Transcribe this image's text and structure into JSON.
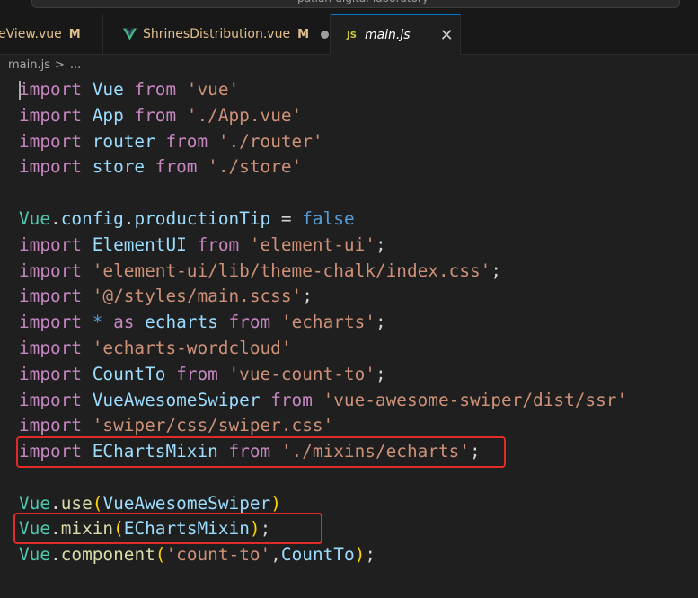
{
  "window": {
    "search_text": "patian-digital-laboratory"
  },
  "tabs": [
    {
      "label": "eView.vue",
      "status": "M"
    },
    {
      "label": "ShrinesDistribution.vue",
      "status": "M",
      "icon": "vue-icon",
      "modified_dot": true
    },
    {
      "label": "main.js",
      "icon_text": "JS",
      "active": true
    }
  ],
  "breadcrumb": {
    "file": "main.js",
    "separator": ">",
    "more": "..."
  },
  "code": {
    "l1": [
      "import",
      " Vue ",
      "from",
      " 'vue'"
    ],
    "l2": [
      "import",
      " App ",
      "from",
      " './App.vue'"
    ],
    "l3": [
      "import",
      " router ",
      "from",
      " './router'"
    ],
    "l4": [
      "import",
      " store ",
      "from",
      " './store'"
    ],
    "l6": [
      "Vue",
      ".",
      "config",
      ".",
      "productionTip",
      " = ",
      "false"
    ],
    "l7": [
      "import",
      " ElementUI ",
      "from",
      " 'element-ui'",
      ";"
    ],
    "l8": [
      "import",
      " 'element-ui/lib/theme-chalk/index.css'",
      ";"
    ],
    "l9": [
      "import",
      " '@/styles/main.scss'",
      ";"
    ],
    "l10": [
      "import",
      " * ",
      "as",
      " echarts ",
      "from",
      " 'echarts'",
      ";"
    ],
    "l11": [
      "import",
      " 'echarts-wordcloud'"
    ],
    "l12": [
      "import",
      " CountTo ",
      "from",
      " 'vue-count-to'",
      ";"
    ],
    "l13": [
      "import",
      " VueAwesomeSwiper ",
      "from",
      " 'vue-awesome-swiper/dist/ssr'"
    ],
    "l14": [
      "import",
      " 'swiper/css/swiper.css'"
    ],
    "l15": [
      "import",
      " EChartsMixin ",
      "from",
      " './mixins/echarts'",
      ";"
    ],
    "l17": [
      "Vue",
      ".",
      "use",
      "(",
      "VueAwesomeSwiper",
      ")"
    ],
    "l18": [
      "Vue",
      ".",
      "mixin",
      "(",
      "EChartsMixin",
      ")",
      ";"
    ],
    "l19": [
      "Vue",
      ".",
      "component",
      "(",
      "'count-to'",
      ",",
      "CountTo",
      ")",
      ";"
    ]
  },
  "colors": {
    "highlight_box": "#e02b2b",
    "background": "#1f1f1f",
    "keyword": "#c586c0",
    "string": "#ce9178"
  }
}
